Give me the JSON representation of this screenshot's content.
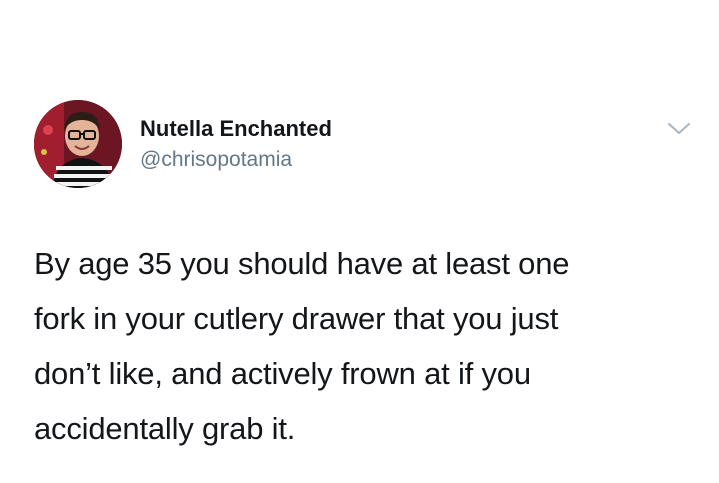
{
  "author": {
    "display_name": "Nutella Enchanted",
    "handle": "@chrisopotamia",
    "avatar_icon": "profile-photo"
  },
  "menu": {
    "icon": "chevron-down-icon"
  },
  "tweet": {
    "lines": [
      "By age 35 you should have at least one",
      "fork in your cutlery drawer that you just",
      "don’t like, and actively frown at if you",
      "accidentally grab it."
    ]
  },
  "colors": {
    "text": "#14171a",
    "secondary": "#657786",
    "background": "#ffffff"
  }
}
